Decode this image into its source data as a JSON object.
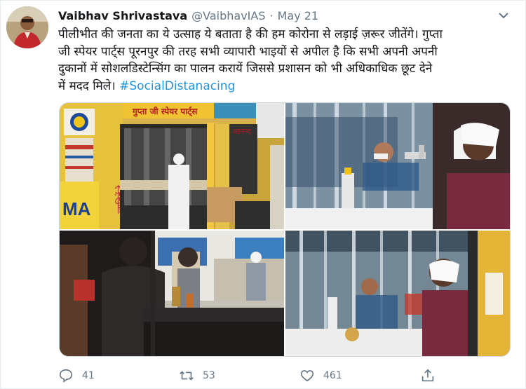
{
  "tweet": {
    "author_name": "Vaibhav Shrivastava",
    "handle": "@VaibhavIAS",
    "separator": "·",
    "date": "May 21",
    "text_line1": "पीलीभीत की जनता का ये उत्साह ये बताता है की हम कोरोना से लड़ाई ज़रूर जीतेंगे। गुप्ता",
    "text_line2": "जी स्पेयर पार्ट्स पूरनपुर की तरह सभी व्यापारी भाइयों से अपील है कि सभी अपनी अपनी",
    "text_line3": "दुकानों में सोशलडिस्टेन्सिंग का पालन करायें जिससे प्रशासन को भी अधिकाधिक छूट देने",
    "text_line4": "में मदद मिले। ",
    "hashtag": "#SocialDistanacing"
  },
  "media": {
    "photo1_sign": "गुप्ता जी स्पेयर पार्ट्स",
    "photo1_side_text": "MA",
    "photo1_lube": "ल्युब्रिकेंटे",
    "photo1_shop2": "आनन्द"
  },
  "actions": {
    "replies": "41",
    "retweets": "53",
    "likes": "461"
  },
  "colors": {
    "link": "#1b95e0",
    "muted": "#657786",
    "border": "#e6ecf0"
  },
  "icons": [
    "chevron-down-icon",
    "reply-icon",
    "retweet-icon",
    "like-icon",
    "share-icon"
  ]
}
